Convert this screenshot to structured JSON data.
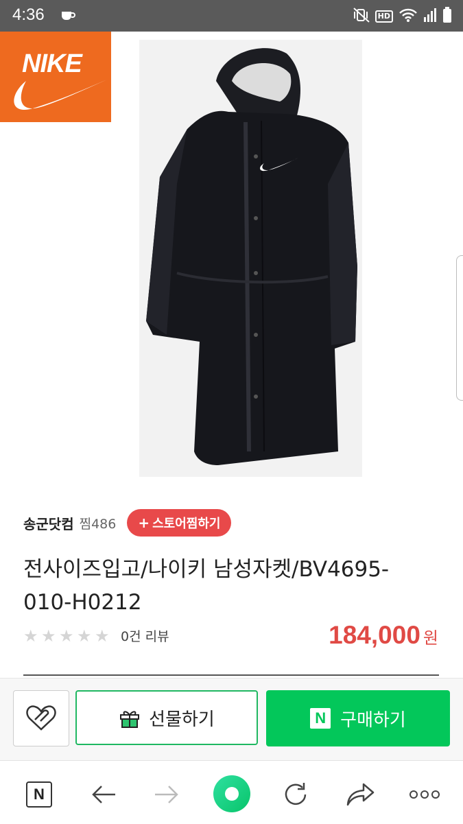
{
  "status_bar": {
    "time": "4:36",
    "hd_label": "HD",
    "icons": [
      "coffee-cup-icon",
      "mute-vibrate-icon",
      "hd-voice-icon",
      "wifi-icon",
      "signal-icon",
      "battery-icon"
    ]
  },
  "brand_logo": {
    "text": "NIKE"
  },
  "product": {
    "image_alt": "black long hooded padded coat",
    "title": "전사이즈입고/나이키 남성자켓/BV4695-010-H0212",
    "review_text": "0건 리뷰",
    "rating_stars": 0,
    "price": "184,000",
    "currency": "원"
  },
  "store": {
    "name": "송군닷컴",
    "zzim": "찜486",
    "favorite_label": "스토어찜하기",
    "favorite_plus": "+"
  },
  "actions": {
    "gift_label": "선물하기",
    "buy_label": "구매하기",
    "npay_badge": "N"
  },
  "browser_nav": {
    "items": [
      "naver-n-icon",
      "back-arrow-icon",
      "forward-arrow-icon",
      "green-dot-home-icon",
      "refresh-icon",
      "share-icon",
      "more-dots-icon"
    ],
    "n_label": "N"
  },
  "colors": {
    "accent_green": "#03c75a",
    "price_red": "#e04a45",
    "store_fav_red": "#e8494a",
    "nike_orange": "#ee6a1f"
  }
}
